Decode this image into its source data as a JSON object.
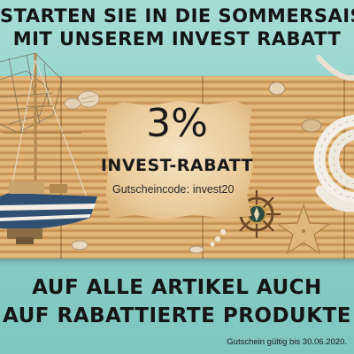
{
  "headline": {
    "line1": "STARTEN SIE IN DIE SOMMERSAISON",
    "line2": "MIT UNSEREM INVEST RABATT"
  },
  "coupon": {
    "percent": "3%",
    "title": "INVEST-RABATT",
    "code_label": "Gutscheincode:",
    "code_value": "invest20"
  },
  "footer": {
    "line1": "AUF ALLE ARTIKEL AUCH",
    "line2": "AUF RABATTIERTE PRODUKTE",
    "validity": "Gutschein gültig bis 30.06.2020."
  },
  "colors": {
    "background": "#8fcfc9",
    "text": "#151515",
    "parchment": "#ebcc9c",
    "bamboo": "#d7a86a"
  },
  "decorations": [
    "sailboat-model",
    "rope-coil",
    "starfish",
    "ship-wheel",
    "compass",
    "seashells",
    "fishing-net"
  ]
}
